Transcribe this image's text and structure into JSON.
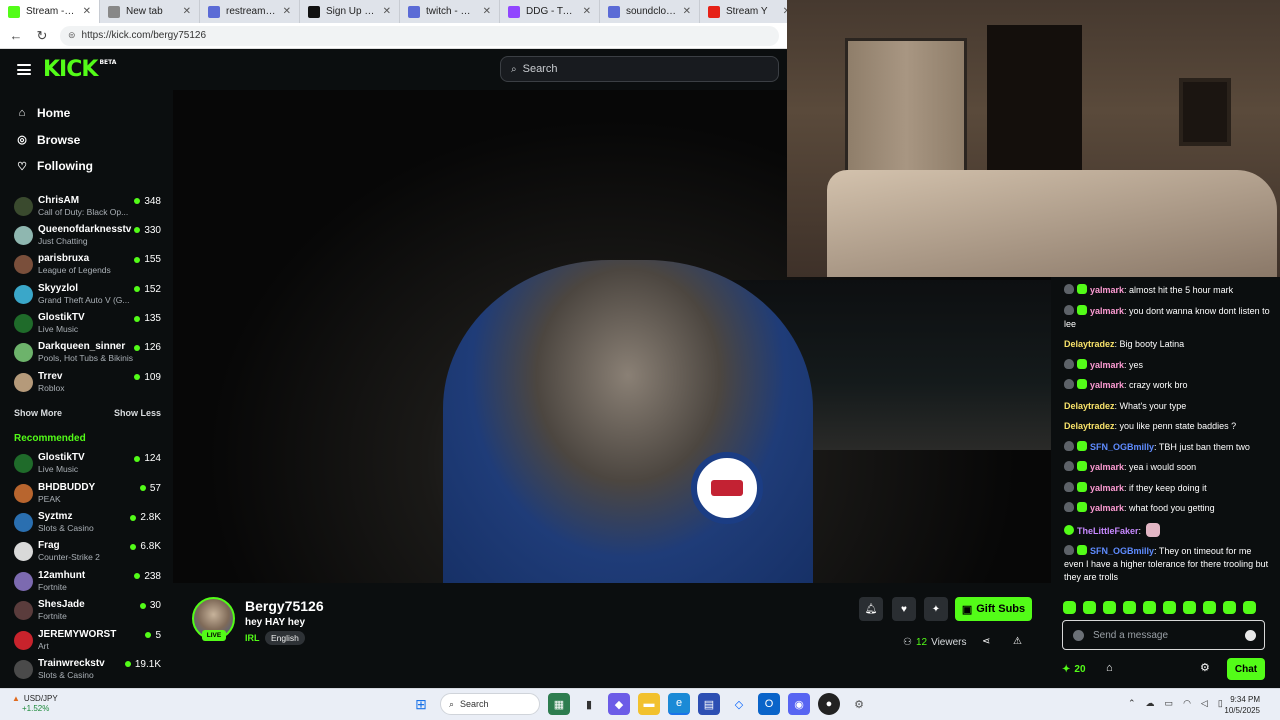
{
  "browser": {
    "tabs": [
      {
        "label": "Stream - Kick Da",
        "favicon": "kick",
        "color": "#53fc18",
        "active": true
      },
      {
        "label": "New tab",
        "favicon": "newtab",
        "color": "#888888",
        "active": false
      },
      {
        "label": "restream - Search",
        "favicon": "search",
        "color": "#5b6bd6",
        "active": false
      },
      {
        "label": "Sign Up - Restre",
        "favicon": "restream",
        "color": "#111111",
        "active": false
      },
      {
        "label": "twitch - Search",
        "favicon": "search",
        "color": "#5b6bd6",
        "active": false
      },
      {
        "label": "DDG - Twitc",
        "favicon": "twitch",
        "color": "#9146ff",
        "active": false
      },
      {
        "label": "soundcloud - Se",
        "favicon": "search",
        "color": "#5b6bd6",
        "active": false
      },
      {
        "label": "Stream Y",
        "favicon": "youtube",
        "color": "#e62117",
        "active": false
      }
    ],
    "url": "https://kick.com/bergy75126"
  },
  "header": {
    "logo": "KICK",
    "logo_sup": "BETA",
    "search_placeholder": "Search"
  },
  "nav": [
    {
      "label": "Home",
      "icon": "home-icon",
      "glyph": "⌂"
    },
    {
      "label": "Browse",
      "icon": "compass-icon",
      "glyph": "◎"
    },
    {
      "label": "Following",
      "icon": "heart-icon",
      "glyph": "♡"
    }
  ],
  "following": [
    {
      "name": "ChrisAM",
      "category": "Call of Duty: Black Op...",
      "viewers": "348",
      "color": "#3a4a2e"
    },
    {
      "name": "Queenofdarknesstv",
      "category": "Just Chatting",
      "viewers": "330",
      "color": "#8fb7b0"
    },
    {
      "name": "parisbruxa",
      "category": "League of Legends",
      "viewers": "155",
      "color": "#7a4f3b"
    },
    {
      "name": "Skyyzlol",
      "category": "Grand Theft Auto V (G...",
      "viewers": "152",
      "color": "#3aa7c9"
    },
    {
      "name": "GlostikTV",
      "category": "Live Music",
      "viewers": "135",
      "color": "#1f6b2a"
    },
    {
      "name": "Darkqueen_sinner",
      "category": "Pools, Hot Tubs & Bikinis",
      "viewers": "126",
      "color": "#6db36b"
    },
    {
      "name": "Trrev",
      "category": "Roblox",
      "viewers": "109",
      "color": "#b59a7a"
    }
  ],
  "show_more": "Show More",
  "show_less": "Show Less",
  "recommended_label": "Recommended",
  "recommended": [
    {
      "name": "GlostikTV",
      "category": "Live Music",
      "viewers": "124",
      "color": "#1f6b2a"
    },
    {
      "name": "BHDBUDDY",
      "category": "PEAK",
      "viewers": "57",
      "color": "#b8652e"
    },
    {
      "name": "Syztmz",
      "category": "Slots & Casino",
      "viewers": "2.8K",
      "color": "#2a6fb0"
    },
    {
      "name": "Frag",
      "category": "Counter-Strike 2",
      "viewers": "6.8K",
      "color": "#d9d9d9"
    },
    {
      "name": "12amhunt",
      "category": "Fortnite",
      "viewers": "238",
      "color": "#7c6ab0"
    },
    {
      "name": "ShesJade",
      "category": "Fortnite",
      "viewers": "30",
      "color": "#5a3c3c"
    },
    {
      "name": "JEREMYWORST",
      "category": "Art",
      "viewers": "5",
      "color": "#c8232c"
    },
    {
      "name": "Trainwreckstv",
      "category": "Slots & Casino",
      "viewers": "19.1K",
      "color": "#4a4a4a"
    }
  ],
  "stream": {
    "streamer": "Bergy75126",
    "title": "hey HAY hey",
    "category": "IRL",
    "tag": "English",
    "live_label": "LIVE",
    "viewers_count": "12",
    "viewers_label": "Viewers",
    "gift_label": "Gift Subs"
  },
  "chat": {
    "messages": [
      {
        "user": "yalmark",
        "color": "#fd9bd3",
        "badges": [
          "shield",
          "gift"
        ],
        "text": "almost hit the 5 hour mark"
      },
      {
        "user": "yalmark",
        "color": "#fd9bd3",
        "badges": [
          "shield",
          "gift"
        ],
        "text": "you dont wanna know dont listen to lee"
      },
      {
        "user": "Delaytradez",
        "color": "#f8e26a",
        "badges": [],
        "text": "Big booty Latina"
      },
      {
        "user": "yalmark",
        "color": "#fd9bd3",
        "badges": [
          "shield",
          "gift"
        ],
        "text": "yes"
      },
      {
        "user": "yalmark",
        "color": "#fd9bd3",
        "badges": [
          "shield",
          "gift"
        ],
        "text": "crazy work bro"
      },
      {
        "user": "Delaytradez",
        "color": "#f8e26a",
        "badges": [],
        "text": "What's your type"
      },
      {
        "user": "Delaytradez",
        "color": "#f8e26a",
        "badges": [],
        "text": "you like penn state baddies ?"
      },
      {
        "user": "SFN_OGBmilly",
        "color": "#5f8cff",
        "badges": [
          "shield",
          "gift"
        ],
        "text": "TBH just ban them two"
      },
      {
        "user": "yalmark",
        "color": "#fd9bd3",
        "badges": [
          "shield",
          "gift"
        ],
        "text": "yea i would soon"
      },
      {
        "user": "yalmark",
        "color": "#fd9bd3",
        "badges": [
          "shield",
          "gift"
        ],
        "text": "if they keep doing it"
      },
      {
        "user": "yalmark",
        "color": "#fd9bd3",
        "badges": [
          "shield",
          "gift"
        ],
        "text": "what food you getting"
      },
      {
        "user": "TheLittleFaker",
        "color": "#c789ff",
        "badges": [
          "green"
        ],
        "text": ""
      },
      {
        "user": "SFN_OGBmilly",
        "color": "#5f8cff",
        "badges": [
          "shield",
          "gift"
        ],
        "text": "They on timeout for me even I have a higher tolerance for there trooling but they are trolls"
      }
    ],
    "input_placeholder": "Send a message",
    "points": "20",
    "chat_button": "Chat"
  },
  "taskbar": {
    "ticker_symbol": "USD/JPY",
    "ticker_change": "+1.52%",
    "search_label": "Search",
    "time": "9:34 PM",
    "date": "10/5/2025"
  }
}
